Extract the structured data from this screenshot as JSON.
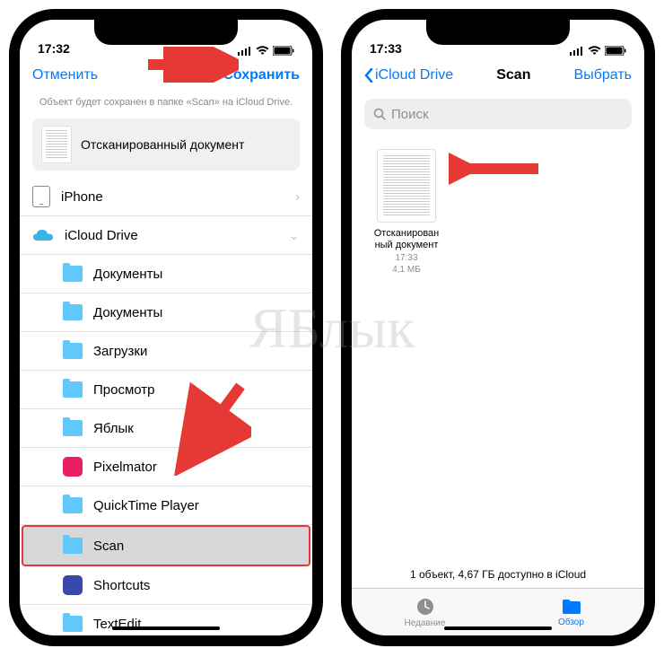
{
  "watermark": "ЯБлык",
  "left": {
    "time": "17:32",
    "cancel": "Отменить",
    "save": "Сохранить",
    "subtext": "Объект будет сохранен в папке «Scan» на iCloud Drive.",
    "docname": "Отсканированный документ",
    "rows": {
      "iphone": "iPhone",
      "icloud": "iCloud Drive",
      "f1": "Документы",
      "f2": "Документы",
      "f3": "Загрузки",
      "f4": "Просмотр",
      "f5": "Яблык",
      "f6": "Pixelmator",
      "f7": "QuickTime Player",
      "f8": "Scan",
      "f9": "Shortcuts",
      "f10": "TextEdit"
    }
  },
  "right": {
    "time": "17:33",
    "back": "iCloud Drive",
    "title": "Scan",
    "select": "Выбрать",
    "search": "Поиск",
    "file": {
      "name": "Отсканирован\nный документ",
      "time": "17:33",
      "size": "4,1 МБ"
    },
    "bottom": "1 объект, 4,67 ГБ доступно в iCloud",
    "tabs": {
      "recent": "Недавние",
      "browse": "Обзор"
    }
  }
}
